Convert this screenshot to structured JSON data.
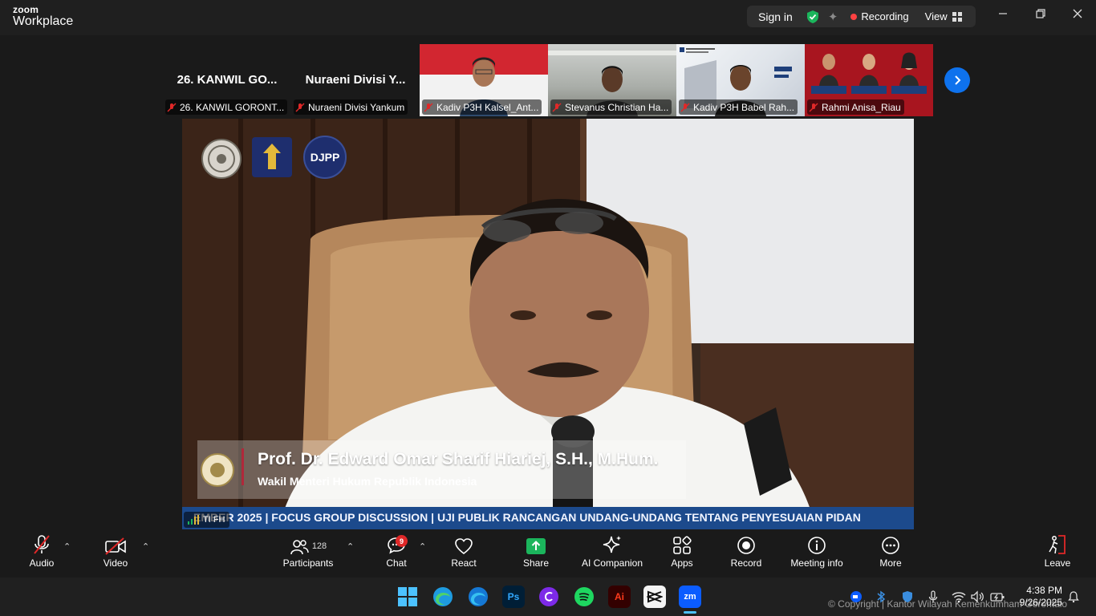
{
  "titlebar": {
    "logo_top": "zoom",
    "logo_bottom": "Workplace",
    "sign_in": "Sign in",
    "recording": "Recording",
    "view": "View"
  },
  "strip": {
    "tiles": [
      {
        "big_name": "26. KANWIL GO...",
        "caption": "26. KANWIL GORONT..."
      },
      {
        "big_name": "Nuraeni Divisi Y...",
        "caption": "Nuraeni Divisi Yankum"
      },
      {
        "big_name": "",
        "caption": "Kadiv P3H Kalsel_Ant..."
      },
      {
        "big_name": "",
        "caption": "Stevanus Christian Ha..."
      },
      {
        "big_name": "",
        "caption": "Kadiv P3H Babel Rah..."
      },
      {
        "big_name": "",
        "caption": "Rahmi Anisa_Riau"
      }
    ]
  },
  "main": {
    "logo3_text": "DJPP",
    "speaker_name": "Prof. Dr. Edward Omar Sharif Hiariej, S.H., M.Hum.",
    "speaker_role": "Wakil Menteri Hukum Republik Indonesia",
    "ticker": "EMBER 2025 | FOCUS GROUP DISCUSSION | UJI PUBLIK RANCANGAN UNDANG-UNDANG TENTANG PENYESUAIAN PIDAN",
    "network_label": "TI FH"
  },
  "toolbar": {
    "audio": "Audio",
    "video": "Video",
    "participants": "Participants",
    "participants_count": "128",
    "chat": "Chat",
    "chat_badge": "9",
    "react": "React",
    "share": "Share",
    "ai_companion": "AI Companion",
    "apps": "Apps",
    "record": "Record",
    "meeting_info": "Meeting info",
    "more": "More",
    "leave": "Leave"
  },
  "taskbar": {
    "time": "4:38 PM",
    "date": "9/26/2025",
    "copyright": "© Copyright | Kantor Wilayah Kemenkumham Gorontalo"
  },
  "colors": {
    "accent_blue": "#0e72ed",
    "share_green": "#1bb55c",
    "record_red": "#ff4242",
    "ticker_blue": "#1c4a8c"
  }
}
